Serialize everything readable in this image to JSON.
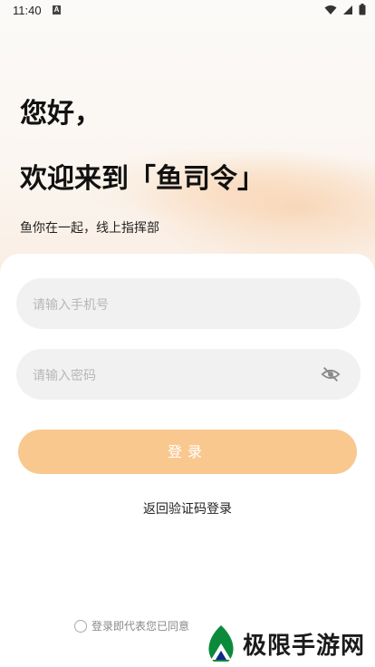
{
  "status_bar": {
    "time": "11:40",
    "notification_glyph": "A",
    "icons": [
      "wifi-icon",
      "cellular-icon",
      "battery-icon"
    ]
  },
  "hero": {
    "greeting_line1": "您好，",
    "greeting_line2": "欢迎来到「鱼司令」",
    "subtitle": "鱼你在一起，线上指挥部"
  },
  "form": {
    "phone_placeholder": "请输入手机号",
    "password_placeholder": "请输入密码",
    "login_label": "登录",
    "switch_link": "返回验证码登录",
    "agreement_text": "登录即代表您已同意"
  },
  "watermark": {
    "text": "极限手游网",
    "logo_icon": "mountain-logo-icon"
  },
  "colors": {
    "login_button": "#f9c88f",
    "field_background": "#f1f1f1",
    "placeholder_text": "#b7b7b7"
  }
}
